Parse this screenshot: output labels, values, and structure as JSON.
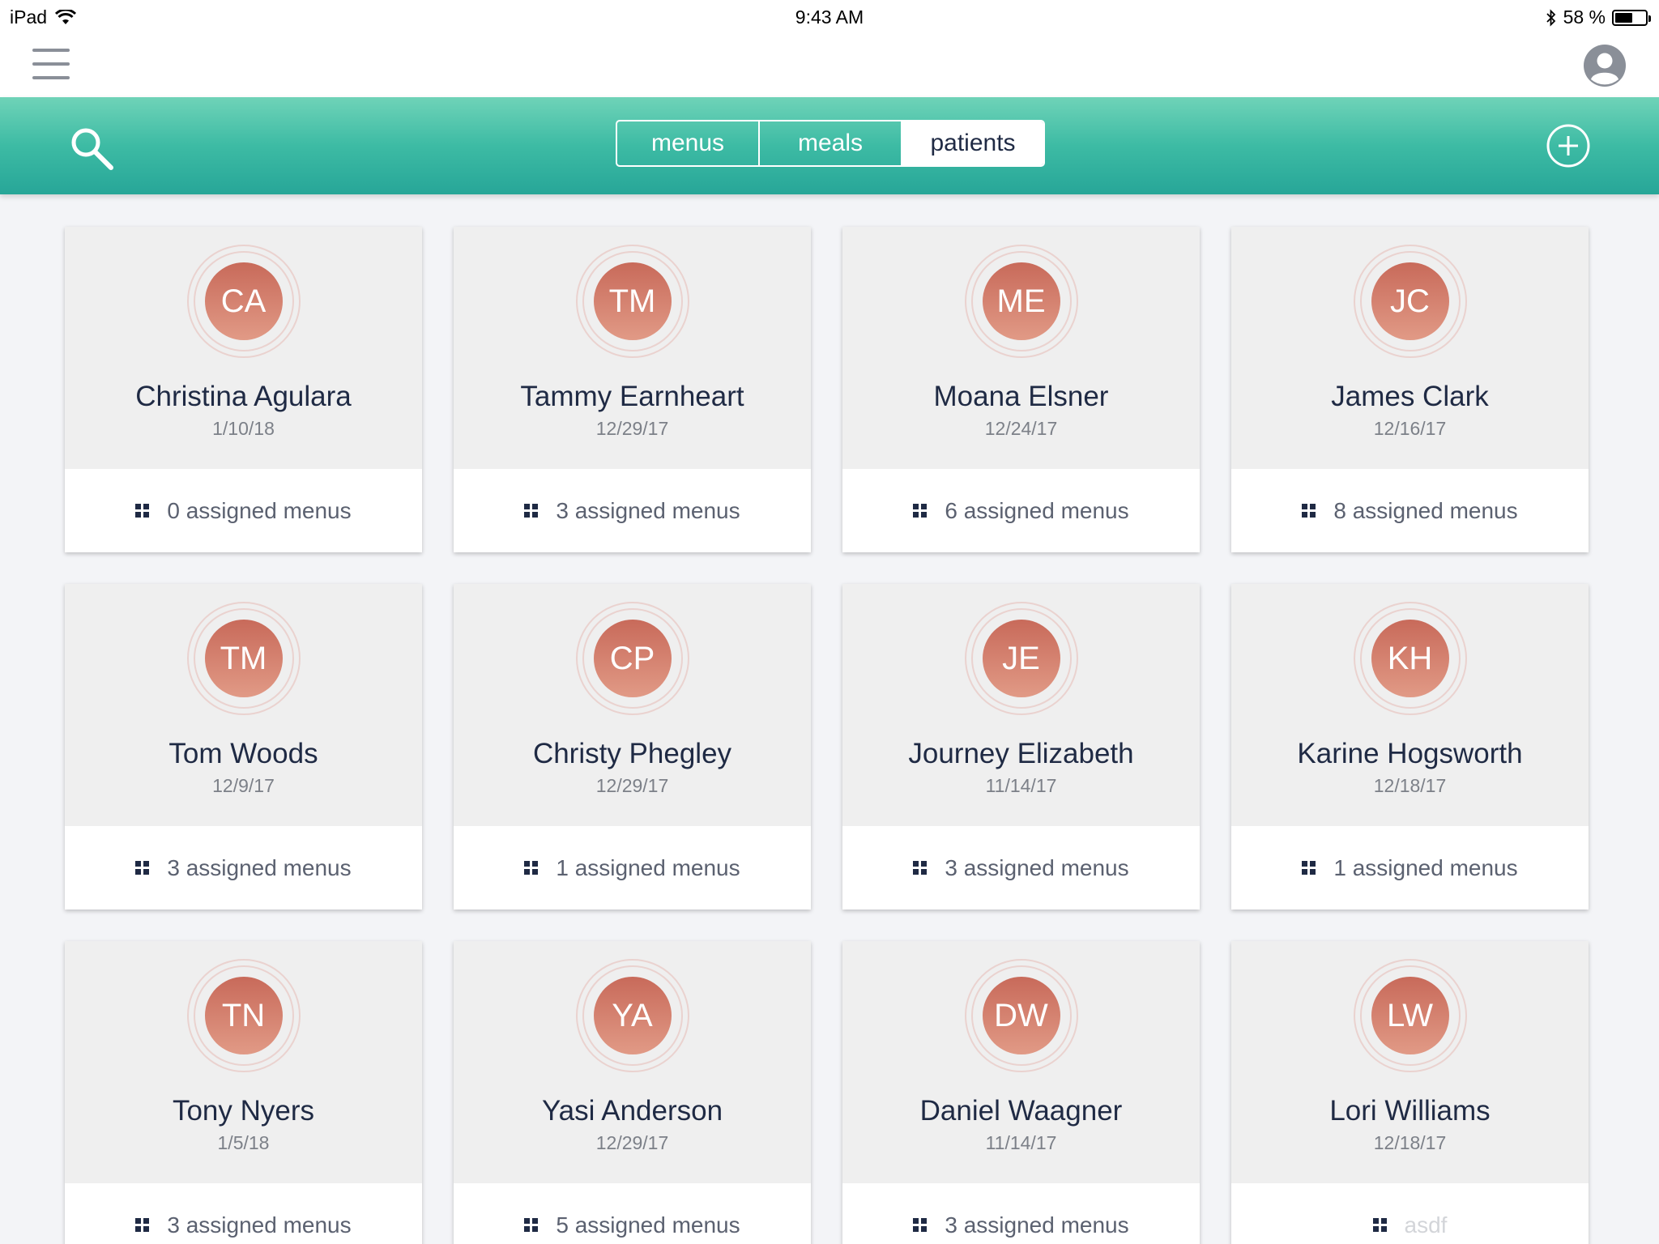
{
  "status_bar": {
    "device": "iPad",
    "time": "9:43 AM",
    "battery": "58 %",
    "battery_level": 0.58
  },
  "header": {
    "menu_icon": "hamburger-icon",
    "account_icon": "account-circle-icon"
  },
  "toolbar": {
    "search_icon": "search-icon",
    "add_icon": "plus-circle-icon",
    "tabs": [
      {
        "label": "menus",
        "active": false
      },
      {
        "label": "meals",
        "active": false
      },
      {
        "label": "patients",
        "active": true
      }
    ],
    "accent_color": "#3dbba4"
  },
  "patients": [
    {
      "initials": "CA",
      "name": "Christina Agulara",
      "date": "1/10/18",
      "menus": "0 assigned menus"
    },
    {
      "initials": "TM",
      "name": "Tammy Earnheart",
      "date": "12/29/17",
      "menus": "3 assigned menus"
    },
    {
      "initials": "ME",
      "name": "Moana Elsner",
      "date": "12/24/17",
      "menus": "6 assigned menus"
    },
    {
      "initials": "JC",
      "name": "James Clark",
      "date": "12/16/17",
      "menus": "8 assigned menus"
    },
    {
      "initials": "TM",
      "name": "Tom Woods",
      "date": "12/9/17",
      "menus": "3 assigned menus"
    },
    {
      "initials": "CP",
      "name": "Christy Phegley",
      "date": "12/29/17",
      "menus": "1 assigned menus"
    },
    {
      "initials": "JE",
      "name": "Journey Elizabeth",
      "date": "11/14/17",
      "menus": "3 assigned menus"
    },
    {
      "initials": "KH",
      "name": "Karine Hogsworth",
      "date": "12/18/17",
      "menus": "1 assigned menus"
    },
    {
      "initials": "TN",
      "name": "Tony Nyers",
      "date": "1/5/18",
      "menus": "3 assigned menus"
    },
    {
      "initials": "YA",
      "name": "Yasi Anderson",
      "date": "12/29/17",
      "menus": "5 assigned menus"
    },
    {
      "initials": "DW",
      "name": "Daniel Waagner",
      "date": "11/14/17",
      "menus": "3 assigned menus"
    },
    {
      "initials": "LW",
      "name": "Lori Williams",
      "date": "12/18/17",
      "menus": "asdf",
      "faded": true
    }
  ]
}
